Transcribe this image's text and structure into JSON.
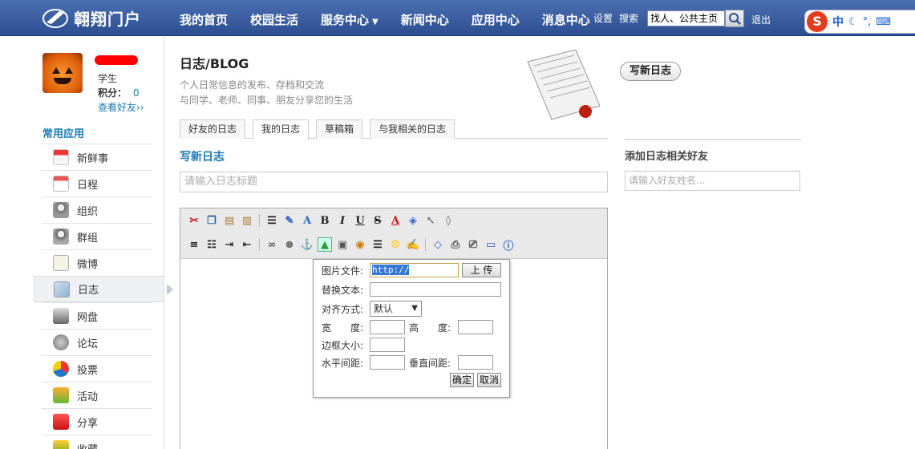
{
  "header": {
    "logo_text": "翱翔门户",
    "nav": [
      {
        "label": "我的首页"
      },
      {
        "label": "校园生活"
      },
      {
        "label": "服务中心",
        "has_dropdown": true
      },
      {
        "label": "新闻中心"
      },
      {
        "label": "应用中心"
      },
      {
        "label": "消息中心"
      }
    ],
    "settings": "设置",
    "search_label": "搜索",
    "search_value": "找人、公共主页",
    "logout": "退出",
    "ime": {
      "logo": "S",
      "mode": "中"
    }
  },
  "profile": {
    "role": "学生",
    "points_label": "积分：",
    "points_value": "0",
    "see_friends": "查看好友››"
  },
  "sidebar": {
    "section_title": "常用应用",
    "items": [
      {
        "label": "新鲜事",
        "icon": "calendar-strip-icon"
      },
      {
        "label": "日程",
        "icon": "calendar-icon"
      },
      {
        "label": "组织",
        "icon": "users-icon"
      },
      {
        "label": "群组",
        "icon": "group-icon"
      },
      {
        "label": "微博",
        "icon": "note-icon"
      },
      {
        "label": "日志",
        "icon": "blog-icon",
        "active": true
      },
      {
        "label": "网盘",
        "icon": "disk-icon"
      },
      {
        "label": "论坛",
        "icon": "forum-icon"
      },
      {
        "label": "投票",
        "icon": "vote-icon"
      },
      {
        "label": "活动",
        "icon": "activity-icon"
      },
      {
        "label": "分享",
        "icon": "share-icon"
      },
      {
        "label": "收藏",
        "icon": "bookmark-icon"
      }
    ]
  },
  "main": {
    "title": "日志/BLOG",
    "desc1": "个人日常信息的发布、存档和交流",
    "desc2": "与同学、老师、同事、朋友分享您的生活",
    "tabs": [
      {
        "label": "好友的日志"
      },
      {
        "label": "我的日志",
        "active": true
      },
      {
        "label": "草稿箱"
      },
      {
        "label": "与我相关的日志"
      }
    ],
    "write_title": "写新日志",
    "title_placeholder": "请输入日志标题"
  },
  "image_dialog": {
    "file_label": "图片文件:",
    "file_value": "http://",
    "upload": "上 传",
    "alt_label": "替换文本:",
    "align_label": "对齐方式:",
    "align_value": "默认",
    "width_label": "宽　　度:",
    "height_label": "高　　度:",
    "border_label": "边框大小:",
    "hspace_label": "水平间距:",
    "vspace_label": "垂直间距:",
    "ok": "确定",
    "cancel": "取消"
  },
  "right": {
    "new_post": "写新日志",
    "section_title": "添加日志相关好友",
    "friend_placeholder": "请输入好友姓名..."
  },
  "colors": {
    "nav_bg": "#3b5f9f",
    "link": "#1a7ab5",
    "ime_red": "#e63a1e"
  }
}
